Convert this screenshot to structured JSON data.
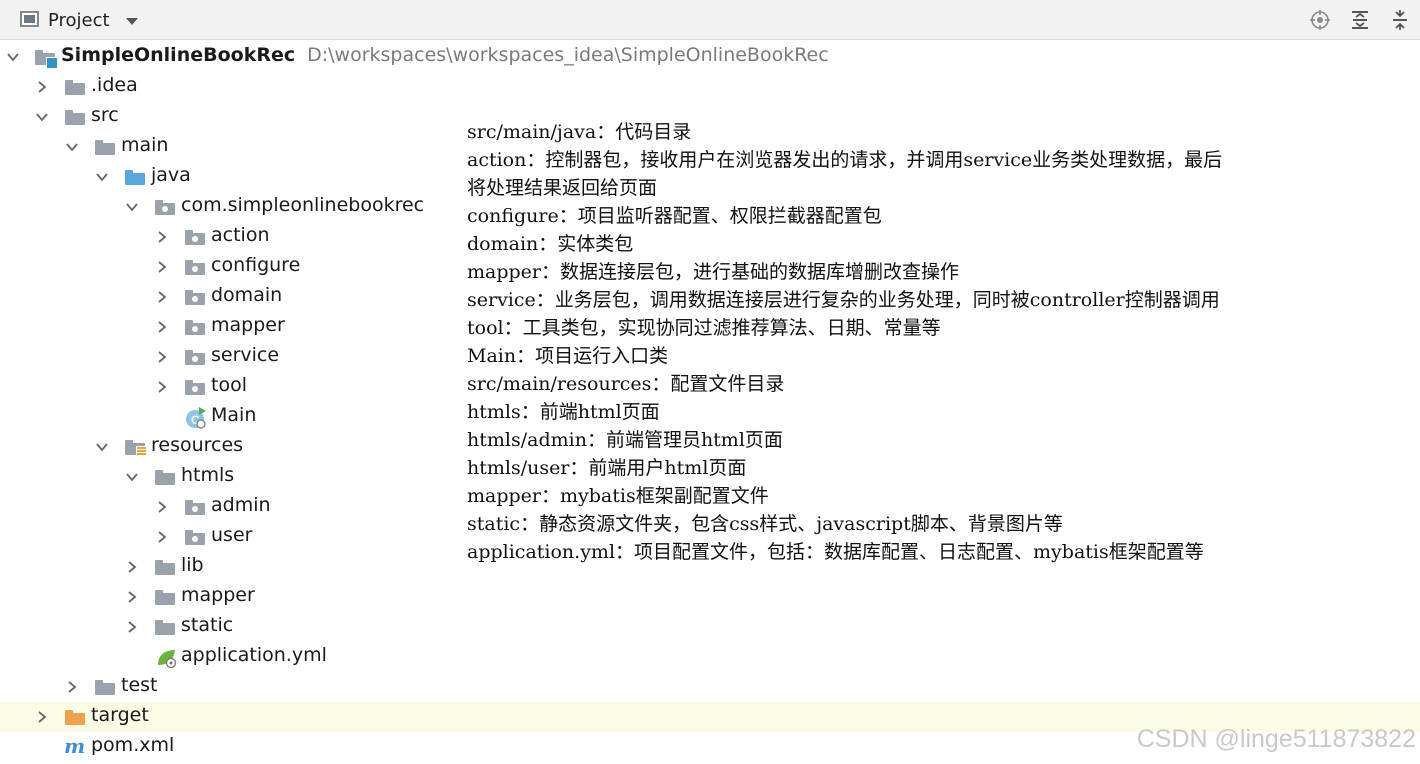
{
  "panel": {
    "title": "Project",
    "icons": [
      "locate-icon",
      "expand-all-icon",
      "collapse-all-icon"
    ]
  },
  "tree": [
    {
      "label": "SimpleOnlineBookRec",
      "path": "D:\\workspaces\\workspaces_idea\\SimpleOnlineBookRec",
      "icon": "module-icon",
      "expanded": true
    },
    {
      "label": ".idea",
      "icon": "folder-icon",
      "expanded": false
    },
    {
      "label": "src",
      "icon": "folder-icon",
      "expanded": true
    },
    {
      "label": "main",
      "icon": "folder-icon",
      "expanded": true
    },
    {
      "label": "java",
      "icon": "source-folder-icon",
      "expanded": true
    },
    {
      "label": "com.simpleonlinebookrec",
      "icon": "package-icon",
      "expanded": true
    },
    {
      "label": "action",
      "icon": "package-icon",
      "expanded": false
    },
    {
      "label": "configure",
      "icon": "package-icon",
      "expanded": false
    },
    {
      "label": "domain",
      "icon": "package-icon",
      "expanded": false
    },
    {
      "label": "mapper",
      "icon": "package-icon",
      "expanded": false
    },
    {
      "label": "service",
      "icon": "package-icon",
      "expanded": false
    },
    {
      "label": "tool",
      "icon": "package-icon",
      "expanded": false
    },
    {
      "label": "Main",
      "icon": "java-class-icon"
    },
    {
      "label": "resources",
      "icon": "resources-folder-icon",
      "expanded": true
    },
    {
      "label": "htmls",
      "icon": "folder-icon",
      "expanded": true
    },
    {
      "label": "admin",
      "icon": "package-icon",
      "expanded": false
    },
    {
      "label": "user",
      "icon": "package-icon",
      "expanded": false
    },
    {
      "label": "lib",
      "icon": "folder-icon",
      "expanded": false
    },
    {
      "label": "mapper",
      "icon": "folder-icon",
      "expanded": false
    },
    {
      "label": "static",
      "icon": "folder-icon",
      "expanded": false
    },
    {
      "label": "application.yml",
      "icon": "yaml-file-icon"
    },
    {
      "label": "test",
      "icon": "folder-icon",
      "expanded": false
    },
    {
      "label": "target",
      "icon": "excluded-folder-icon",
      "expanded": false
    },
    {
      "label": "pom.xml",
      "icon": "maven-file-icon"
    }
  ],
  "notes": [
    "src/main/java：代码目录",
    "action：控制器包，接收用户在浏览器发出的请求，并调用service业务类处理数据，最后",
    "将处理结果返回给页面",
    "configure：项目监听器配置、权限拦截器配置包",
    "domain：实体类包",
    "mapper：数据连接层包，进行基础的数据库增删改查操作",
    "service：业务层包，调用数据连接层进行复杂的业务处理，同时被controller控制器调用",
    "tool：工具类包，实现协同过滤推荐算法、日期、常量等",
    "Main：项目运行入口类",
    "src/main/resources：配置文件目录",
    "htmls：前端html页面",
    "htmls/admin：前端管理员html页面",
    "htmls/user：前端用户html页面",
    "mapper：mybatis框架副配置文件",
    "static：静态资源文件夹，包含css样式、javascript脚本、背景图片等",
    "application.yml：项目配置文件，包括：数据库配置、日志配置、mybatis框架配置等"
  ],
  "watermark": "CSDN @linge511873822",
  "colors": {
    "header_bg": "#f2f2f2",
    "folder": "#9aa3ab",
    "source_folder": "#5ba6dd",
    "excluded_folder": "#f0a051",
    "selected_row": "#fcfbe6"
  }
}
